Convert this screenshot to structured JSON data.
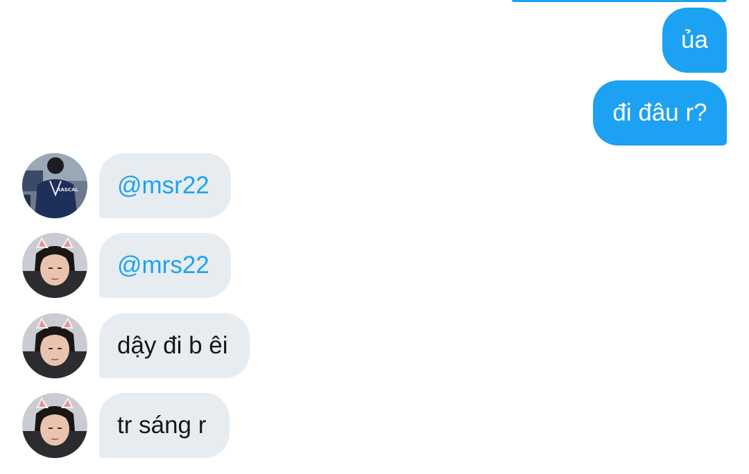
{
  "conversation": {
    "messages": [
      {
        "direction": "out",
        "text": "ủa"
      },
      {
        "direction": "out",
        "text": "đi đâu r?"
      },
      {
        "direction": "in",
        "avatar": "avatar-rascal-jacket",
        "text": "@msr22",
        "mention": true
      },
      {
        "direction": "in",
        "avatar": "avatar-cat-ears",
        "text": "@mrs22",
        "mention": true
      },
      {
        "direction": "in",
        "avatar": "avatar-cat-ears",
        "text": "dậy đi b êi"
      },
      {
        "direction": "in",
        "avatar": "avatar-cat-ears",
        "text": "tr sáng r"
      }
    ],
    "avatar1_jacket_text": "RASCAL"
  },
  "colors": {
    "outgoing_bubble": "#1DA1F2",
    "incoming_bubble": "#E6ECF0",
    "mention": "#1DA1F2",
    "incoming_text": "#14171A",
    "background": "#FFFFFF"
  }
}
